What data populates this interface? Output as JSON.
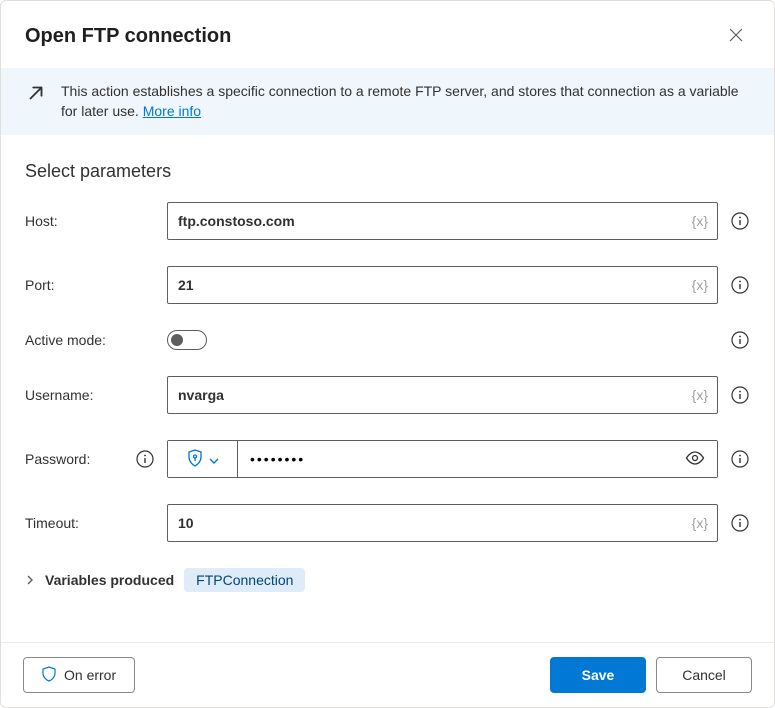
{
  "dialog": {
    "title": "Open FTP connection",
    "banner_text": "This action establishes a specific connection to a remote FTP server, and stores that connection as a variable for later use. ",
    "more_info_label": "More info"
  },
  "section_title": "Select parameters",
  "fields": {
    "host": {
      "label": "Host:",
      "value": "ftp.constoso.com"
    },
    "port": {
      "label": "Port:",
      "value": "21"
    },
    "active_mode": {
      "label": "Active mode:",
      "value": false
    },
    "username": {
      "label": "Username:",
      "value": "nvarga"
    },
    "password": {
      "label": "Password:",
      "value": "••••••••"
    },
    "timeout": {
      "label": "Timeout:",
      "value": "10"
    }
  },
  "variables": {
    "label": "Variables produced",
    "chip": "FTPConnection"
  },
  "footer": {
    "on_error": "On error",
    "save": "Save",
    "cancel": "Cancel"
  }
}
